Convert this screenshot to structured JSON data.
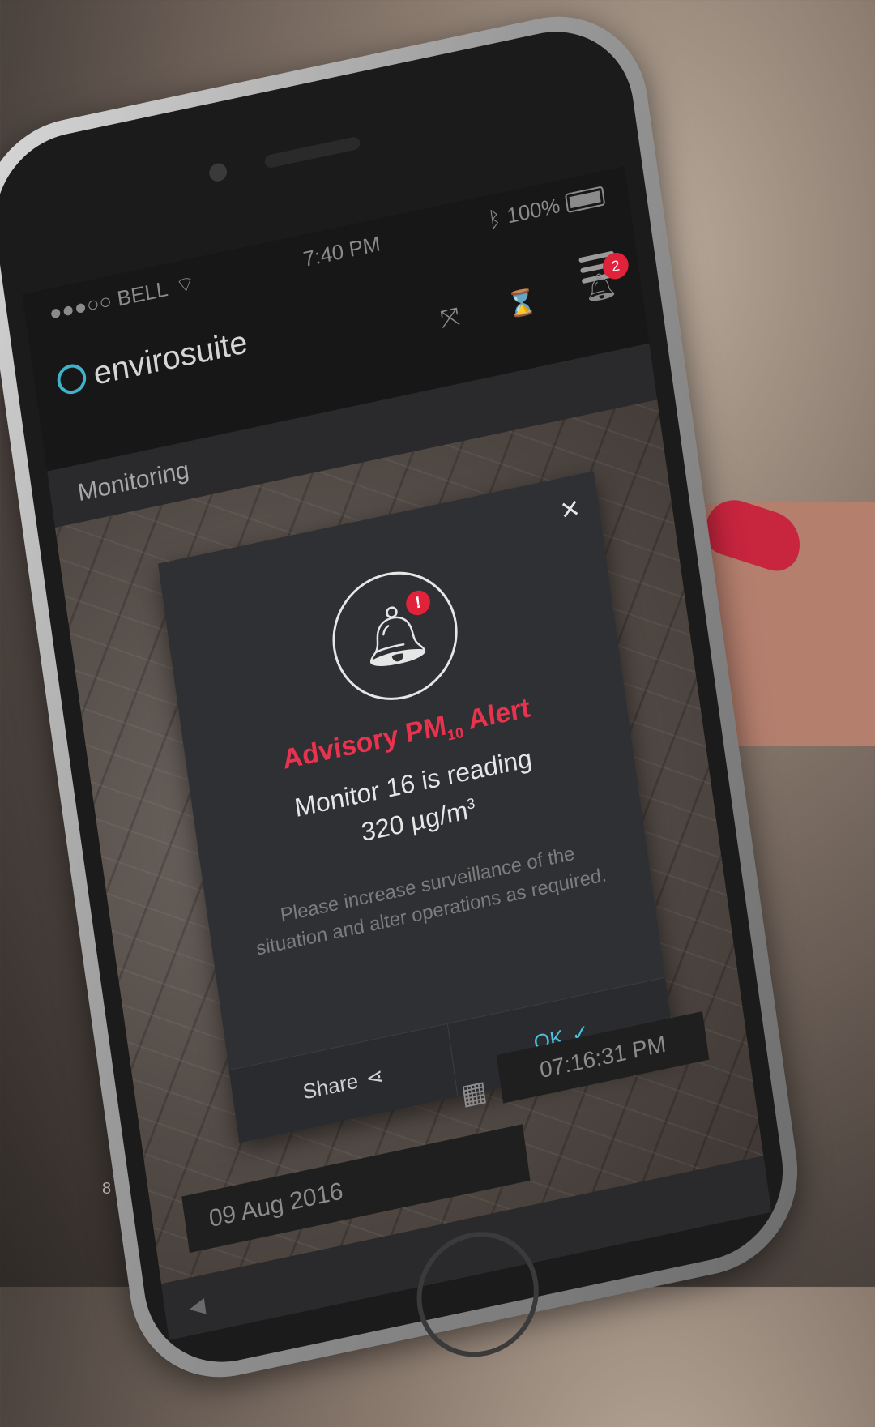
{
  "page": {
    "number": "8"
  },
  "status_bar": {
    "carrier": "●●●○○ BELL",
    "time": "7:40 PM",
    "battery": "100%"
  },
  "app": {
    "name": "envirosuite",
    "notifications_count": "2",
    "section": "Monitoring"
  },
  "modal": {
    "close_label": "×",
    "title_prefix": "Advisory PM",
    "title_subscript": "10",
    "title_suffix": "Alert",
    "reading_line1": "Monitor 16 is reading",
    "reading_value": "320 µg/m",
    "reading_superscript": "3",
    "body": "Please increase surveillance of the situation and alter operations as required.",
    "share_label": "Share",
    "ok_label": "OK"
  },
  "timeline": {
    "date": "09 Aug 2016",
    "time": "07:16:31 PM"
  },
  "colors": {
    "alert_red": "#e0223b",
    "ok_accent": "#4cc0dc",
    "logo_accent": "#3fb3c9"
  }
}
